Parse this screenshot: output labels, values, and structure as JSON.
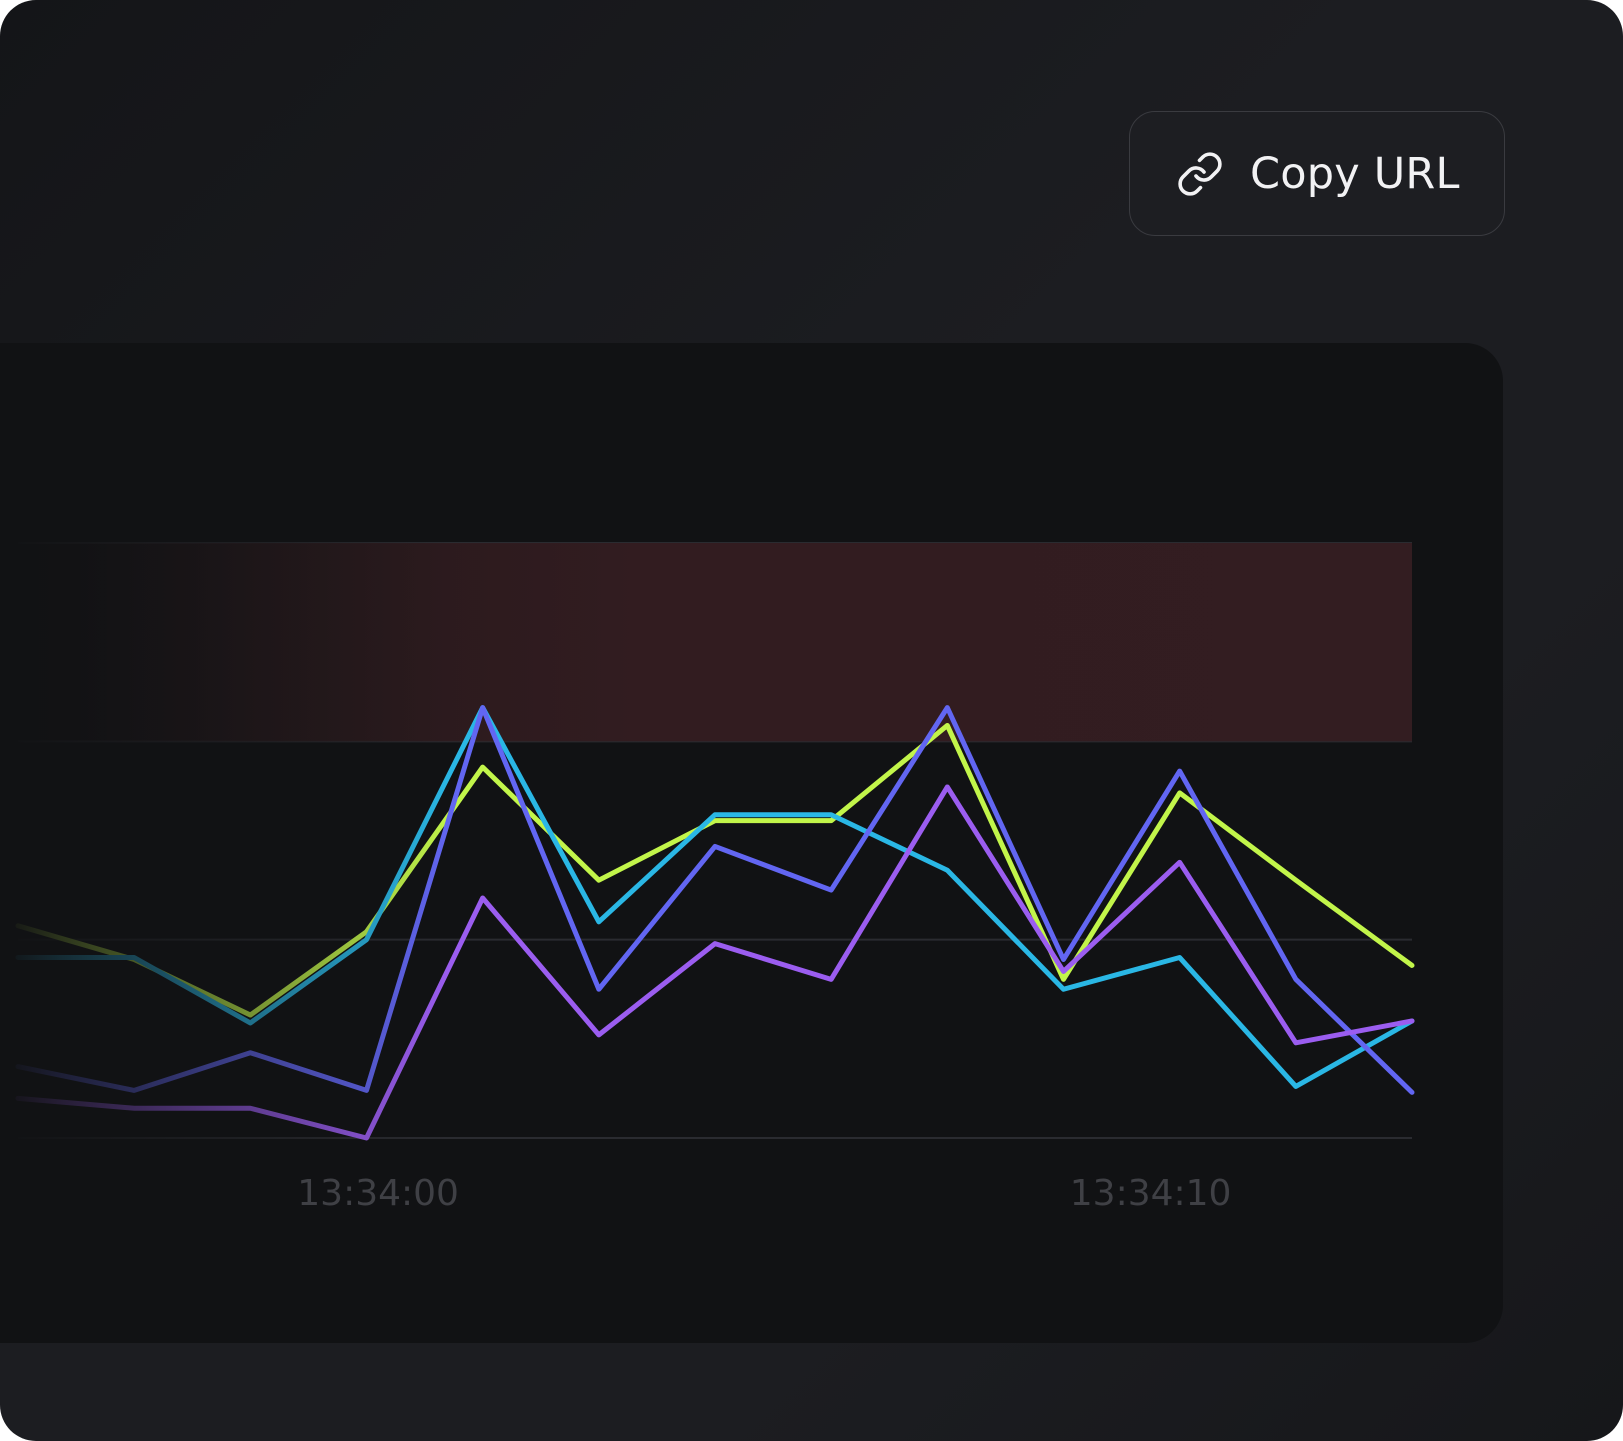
{
  "toolbar": {
    "copy_url_label": "Copy URL",
    "copy_url_icon": "link-icon"
  },
  "colors": {
    "background": "#1c1d21",
    "panel": "#111214",
    "threshold": "#e5484d",
    "threshold_band": "#311c20"
  },
  "chart_data": {
    "type": "line",
    "x": [
      0,
      1,
      2,
      3,
      4,
      5,
      6,
      7,
      8,
      9,
      10,
      11,
      12
    ],
    "tick_labels": [
      {
        "x": 3.1,
        "label": "13:34:00"
      },
      {
        "x": 9.75,
        "label": "13:34:10"
      }
    ],
    "ylim": [
      0,
      3
    ],
    "gridlines": [
      0,
      1,
      2,
      3
    ],
    "threshold": 2,
    "series": [
      {
        "color": "#c2f54a",
        "values": [
          1.07,
          0.9,
          0.62,
          1.04,
          1.87,
          1.3,
          1.6,
          1.6,
          2.08,
          0.8,
          1.74,
          1.3,
          0.87
        ]
      },
      {
        "color": "#2ab7e5",
        "values": [
          0.91,
          0.91,
          0.58,
          1.0,
          2.17,
          1.09,
          1.63,
          1.63,
          1.35,
          0.75,
          0.91,
          0.26,
          0.59
        ]
      },
      {
        "color": "#6266f2",
        "values": [
          0.36,
          0.24,
          0.43,
          0.24,
          2.17,
          0.75,
          1.47,
          1.25,
          2.17,
          0.9,
          1.85,
          0.8,
          0.23
        ]
      },
      {
        "color": "#9b5df0",
        "values": [
          0.2,
          0.15,
          0.15,
          0.0,
          1.21,
          0.52,
          0.98,
          0.8,
          1.77,
          0.84,
          1.39,
          0.48,
          0.59
        ]
      }
    ]
  }
}
